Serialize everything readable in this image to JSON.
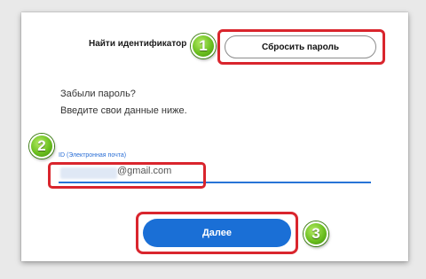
{
  "header": {
    "find_id_label": "Найти идентификатор",
    "reset_password_label": "Сбросить пароль"
  },
  "badges": {
    "one": "1",
    "two": "2",
    "three": "3"
  },
  "intro": {
    "line1": "Забыли пароль?",
    "line2": "Введите свои данные ниже."
  },
  "email_field": {
    "label": "ID (Электронная почта)",
    "value_suffix": "@gmail.com"
  },
  "actions": {
    "next_label": "Далее"
  },
  "colors": {
    "accent": "#1a6fd6",
    "highlight": "#d9252d",
    "badge": "#6cc020"
  }
}
